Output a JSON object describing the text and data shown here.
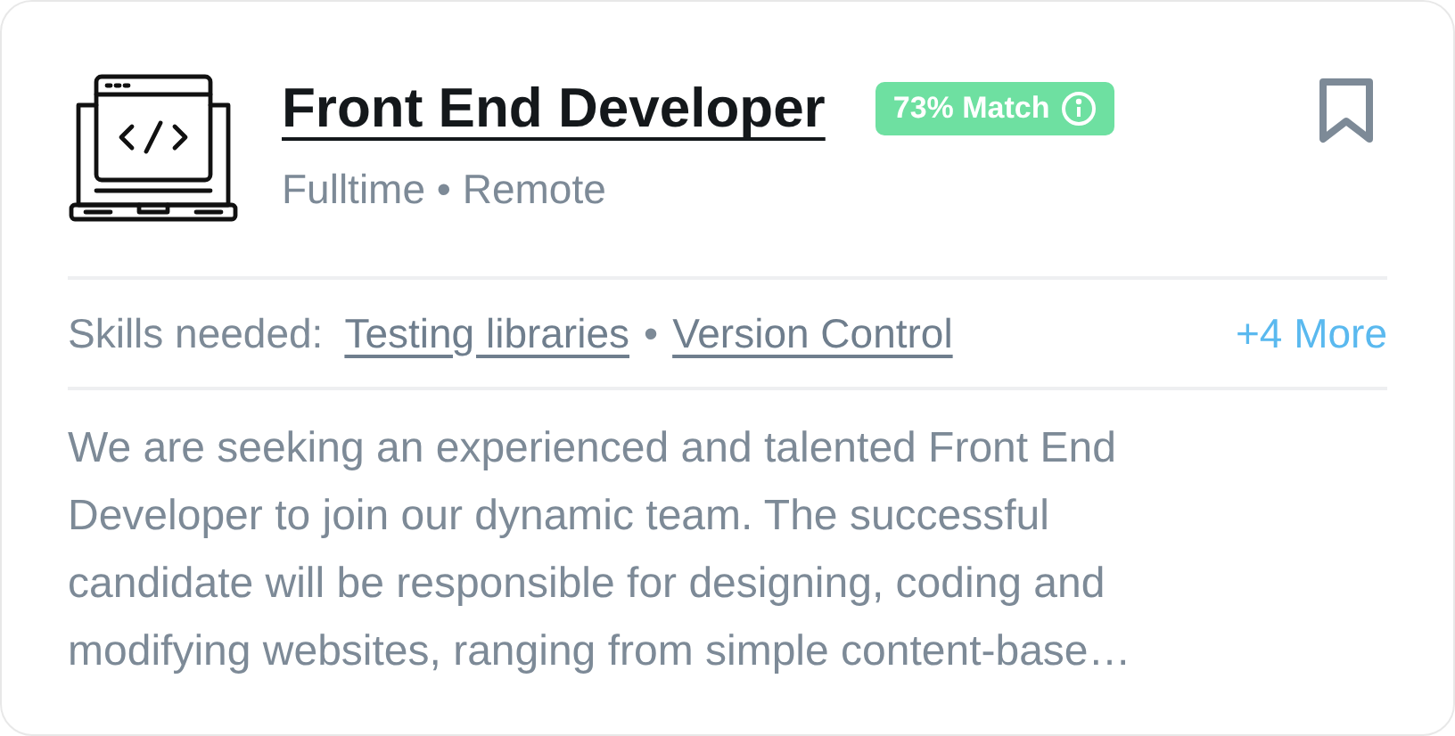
{
  "job": {
    "title": "Front End Developer",
    "match_badge": "73% Match",
    "subtitle": "Fulltime • Remote",
    "bookmarked": false
  },
  "skills": {
    "label": "Skills needed:",
    "separator": "•",
    "items": [
      "Testing libraries",
      "Version Control"
    ],
    "more": "+4 More"
  },
  "description_lines": [
    "We are seeking an experienced and talented Front End",
    "Developer to join our dynamic team. The successful",
    "candidate will be responsible for designing, coding and",
    "modifying websites, ranging from simple content-base…"
  ]
}
